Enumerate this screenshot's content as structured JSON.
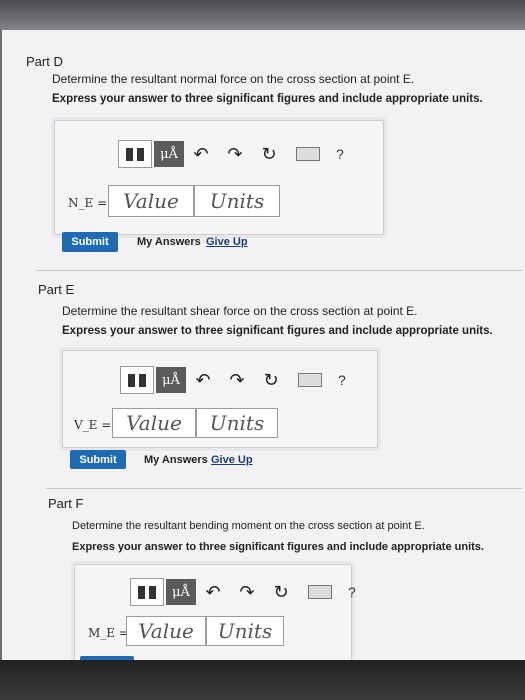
{
  "parts": [
    {
      "title": "Part D",
      "question": "Determine the resultant normal force on the cross section at point E.",
      "instruction": "Express your answer to three significant figures and include appropriate units.",
      "lhs": "N_E =",
      "value_placeholder": "Value",
      "units_placeholder": "Units",
      "submit": "Submit",
      "my_answers": "My Answers",
      "give_up": "Give Up"
    },
    {
      "title": "Part E",
      "question": "Determine the resultant shear force on the cross section at point E.",
      "instruction": "Express your answer to three significant figures and include appropriate units.",
      "lhs": "V_E =",
      "value_placeholder": "Value",
      "units_placeholder": "Units",
      "submit": "Submit",
      "my_answers": "My Answers",
      "give_up": "Give Up"
    },
    {
      "title": "Part F",
      "question": "Determine the resultant bending moment on the cross section at point E.",
      "instruction": "Express your answer to three significant figures and include appropriate units.",
      "lhs": "M_E =",
      "value_placeholder": "Value",
      "units_placeholder": "Units"
    }
  ],
  "toolbar": {
    "templates_icon": "templates-icon",
    "mu_label": "μÅ",
    "undo_icon": "undo-icon",
    "redo_icon": "redo-icon",
    "reset_icon": "reset-icon",
    "keyboard_icon": "keyboard-icon",
    "help_label": "?"
  }
}
